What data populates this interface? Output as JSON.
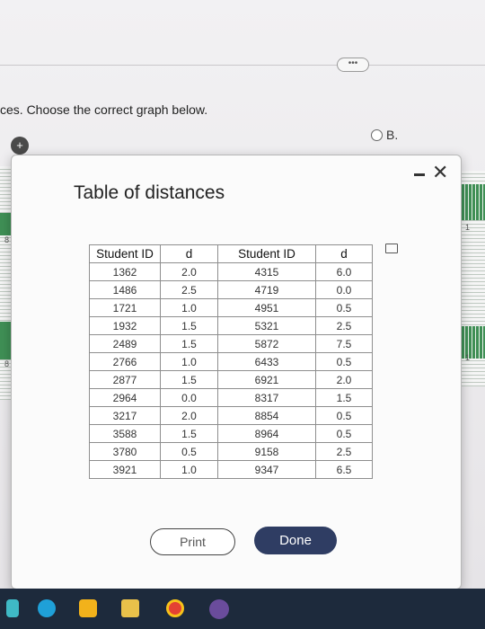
{
  "page": {
    "more_button": "•••",
    "prompt": "ces. Choose the correct graph below.",
    "option_b": "B.",
    "left_ticks": [
      "8",
      "8"
    ],
    "right_ticks": [
      "1",
      "1"
    ]
  },
  "modal": {
    "title": "Table of distances",
    "close": "✕",
    "columns": [
      "Student ID",
      "d",
      "Student ID",
      "d"
    ],
    "rows": [
      [
        "1362",
        "2.0",
        "4315",
        "6.0"
      ],
      [
        "1486",
        "2.5",
        "4719",
        "0.0"
      ],
      [
        "1721",
        "1.0",
        "4951",
        "0.5"
      ],
      [
        "1932",
        "1.5",
        "5321",
        "2.5"
      ],
      [
        "2489",
        "1.5",
        "5872",
        "7.5"
      ],
      [
        "2766",
        "1.0",
        "6433",
        "0.5"
      ],
      [
        "2877",
        "1.5",
        "6921",
        "2.0"
      ],
      [
        "2964",
        "0.0",
        "8317",
        "1.5"
      ],
      [
        "3217",
        "2.0",
        "8854",
        "0.5"
      ],
      [
        "3588",
        "1.5",
        "8964",
        "0.5"
      ],
      [
        "3780",
        "0.5",
        "9158",
        "2.5"
      ],
      [
        "3921",
        "1.0",
        "9347",
        "6.5"
      ]
    ],
    "print_label": "Print",
    "done_label": "Done"
  },
  "taskbar": {
    "icons": [
      "app-icon",
      "edge-browser-icon",
      "file-explorer-icon",
      "store-icon",
      "chrome-icon",
      "teams-icon"
    ]
  }
}
